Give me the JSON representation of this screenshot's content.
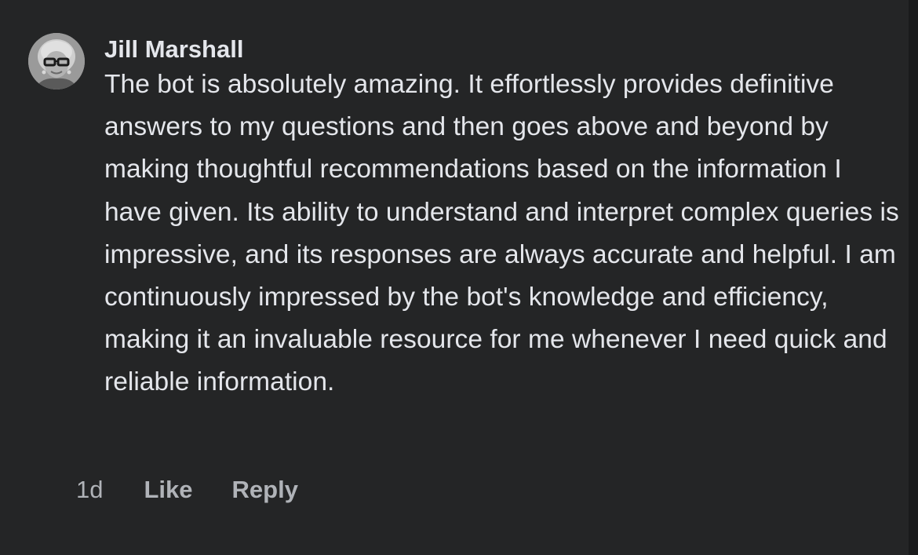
{
  "comment": {
    "author": "Jill Marshall",
    "avatar_icon": "user-avatar-photo",
    "text": "The bot is absolutely amazing. It effortlessly provides definitive answers to my questions and then goes above and beyond by making thoughtful recommendations based on the information I have given. Its ability to understand and interpret complex queries is impressive, and its responses are always accurate and helpful. I am continuously impressed by the bot's knowledge and efficiency, making it an invaluable resource for me whenever I need quick and reliable information.",
    "timestamp": "1d",
    "like_label": "Like",
    "reply_label": "Reply"
  },
  "colors": {
    "background": "#242526",
    "text_primary": "#e4e6eb",
    "text_secondary": "#b0b3b8"
  }
}
